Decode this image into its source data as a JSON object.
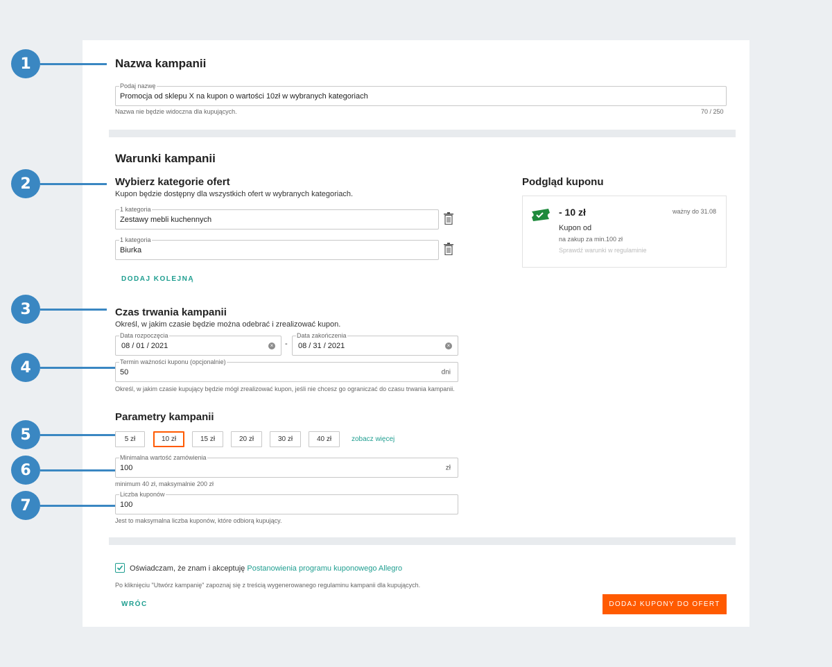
{
  "markers": [
    "1",
    "2",
    "3",
    "4",
    "5",
    "6",
    "7"
  ],
  "name_section": {
    "title": "Nazwa kampanii",
    "field_label": "Podaj nazwę",
    "field_value": "Promocja od sklepu X na kupon o wartości 10zł w  wybranych kategoriach",
    "hint": "Nazwa nie będzie widoczna dla kupujących.",
    "counter": "70 / 250"
  },
  "conditions": {
    "title": "Warunki kampanii",
    "categories": {
      "title": "Wybierz kategorie ofert",
      "description": "Kupon będzie dostępny dla wszystkich ofert w wybranych kategoriach.",
      "items": [
        {
          "label": "1 kategoria",
          "value": "Zestawy mebli kuchennych"
        },
        {
          "label": "1 kategoria",
          "value": "Biurka"
        }
      ],
      "add_label": "DODAJ KOLEJNĄ"
    },
    "duration": {
      "title": "Czas trwania kampanii",
      "description": "Określ, w jakim czasie będzie można odebrać i zrealizować kupon.",
      "start_label": "Data rozpoczęcia",
      "start_value": "08 / 01 / 2021",
      "separator": "-",
      "end_label": "Data zakończenia",
      "end_value": "08 / 31 / 2021",
      "validity_label": "Termin ważności kuponu (opcjonalnie)",
      "validity_value": "50",
      "validity_unit": "dni",
      "validity_hint": "Określ, w jakim czasie kupujący będzie mógł zrealizować kupon, jeśli nie chcesz go ograniczać do czasu trwania kampanii."
    },
    "parameters": {
      "title": "Parametry kampanii",
      "amounts": [
        "5 zł",
        "10 zł",
        "15 zł",
        "20 zł",
        "30 zł",
        "40 zł"
      ],
      "selected_amount": "10 zł",
      "more_label": "zobacz więcej",
      "min_order_label": "Minimalna wartość zamówienia",
      "min_order_value": "100",
      "min_order_unit": "zł",
      "min_order_hint": "minimum 40 zł, maksymalnie 200 zł",
      "coupons_label": "Liczba kuponów",
      "coupons_value": "100",
      "coupons_hint": "Jest to maksymalna liczba kuponów, które odbiorą kupujący."
    }
  },
  "preview": {
    "title": "Podgląd kuponu",
    "amount": "- 10 zł",
    "valid_until": "ważny do 31.08",
    "coupon_from": "Kupon od",
    "min_purchase": "na zakup za min.100 zł",
    "terms": "Sprawdź warunki w regulaminie"
  },
  "footer": {
    "consent_prefix": "Oświadczam, że znam i akceptuję ",
    "consent_link": "Postanowienia programu kuponowego Allegro",
    "consent_checked": true,
    "note": "Po kliknięciu \"Utwórz kampanię\" zapoznaj się z treścią wygenerowanego regulaminu kampanii dla kupujących.",
    "back_label": "WRÓC",
    "submit_label": "DODAJ KUPONY DO OFERT"
  },
  "colors": {
    "accent": "#ff5a00",
    "teal": "#1f9e90",
    "marker": "#3a87c2",
    "ticket": "#1e8a3c"
  }
}
